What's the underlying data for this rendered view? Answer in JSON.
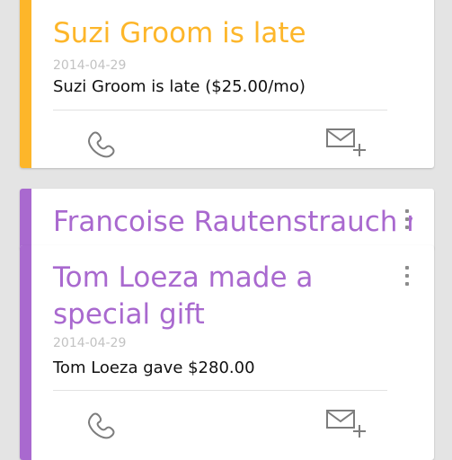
{
  "colors": {
    "late_accent": "#fdb62a",
    "gift_accent": "#a969cf",
    "late_title": "#fdb62a",
    "gift_title": "#a969cf",
    "date_text": "#c2c2c2",
    "body_text": "#111111"
  },
  "cards": [
    {
      "title": "Suzi Groom is late",
      "date": "2014-04-29",
      "body": "Suzi Groom is late ($25.00/mo)",
      "actions": {
        "call_icon": "phone-icon",
        "email_icon": "add-email-icon"
      }
    },
    {
      "title": "Francoise Rautenstrauch made a special gift"
    },
    {
      "title_line_1": "Tom Loeza made a",
      "title_line_2": "special gift",
      "date": "2014-04-29",
      "body": "Tom Loeza gave $280.00",
      "actions": {
        "call_icon": "phone-icon",
        "email_icon": "add-email-icon"
      }
    }
  ]
}
